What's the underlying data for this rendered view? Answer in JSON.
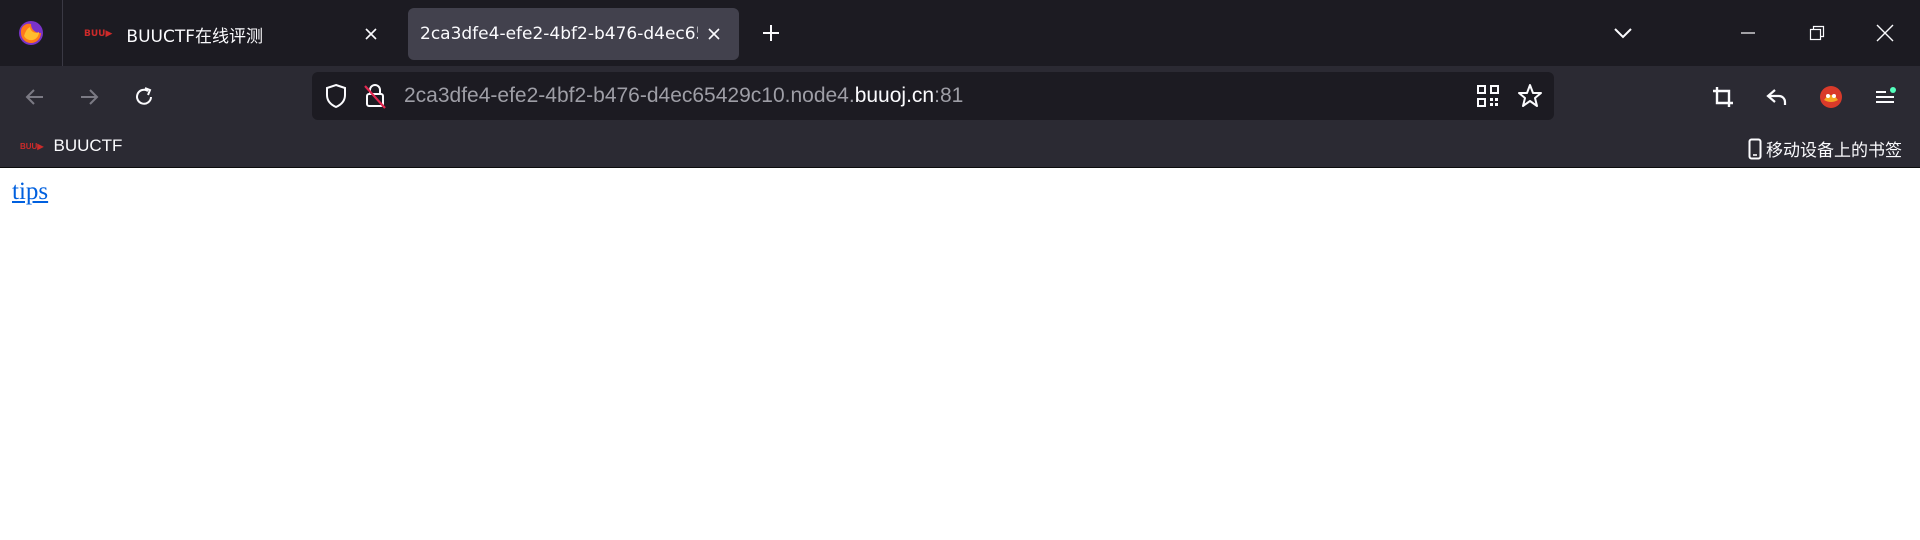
{
  "tabs": [
    {
      "title": "BUUCTF在线评测",
      "favicon": "buuctf-favicon",
      "active": false
    },
    {
      "title": "2ca3dfe4-efe2-4bf2-b476-d4ec65429c10.node4.buuoj.cn:81",
      "active": true
    }
  ],
  "url": {
    "prefix": "2ca3dfe4-efe2-4bf2-b476-d4ec65429c10.node4.",
    "host": "buuoj.cn",
    "port": ":81"
  },
  "bookmarks": {
    "items": [
      {
        "label": "BUUCTF",
        "favicon": "buuctf-favicon"
      }
    ],
    "mobile_label": "移动设备上的书签"
  },
  "page": {
    "link_text": "tips"
  },
  "icons": {
    "app": "firefox-icon",
    "tracking": "shield-icon",
    "security": "insecure-lock-icon",
    "qr": "qr-code-icon",
    "bookmark": "star-icon",
    "crop": "crop-icon",
    "reply": "reply-icon",
    "extension": "extension-icon",
    "menu": "hamburger-menu-icon"
  },
  "colors": {
    "tabbar_bg": "#1c1b22",
    "toolbar_bg": "#2b2a33",
    "active_tab_bg": "#42414d",
    "link": "#0060df",
    "notification_dot": "#54ffbd"
  }
}
